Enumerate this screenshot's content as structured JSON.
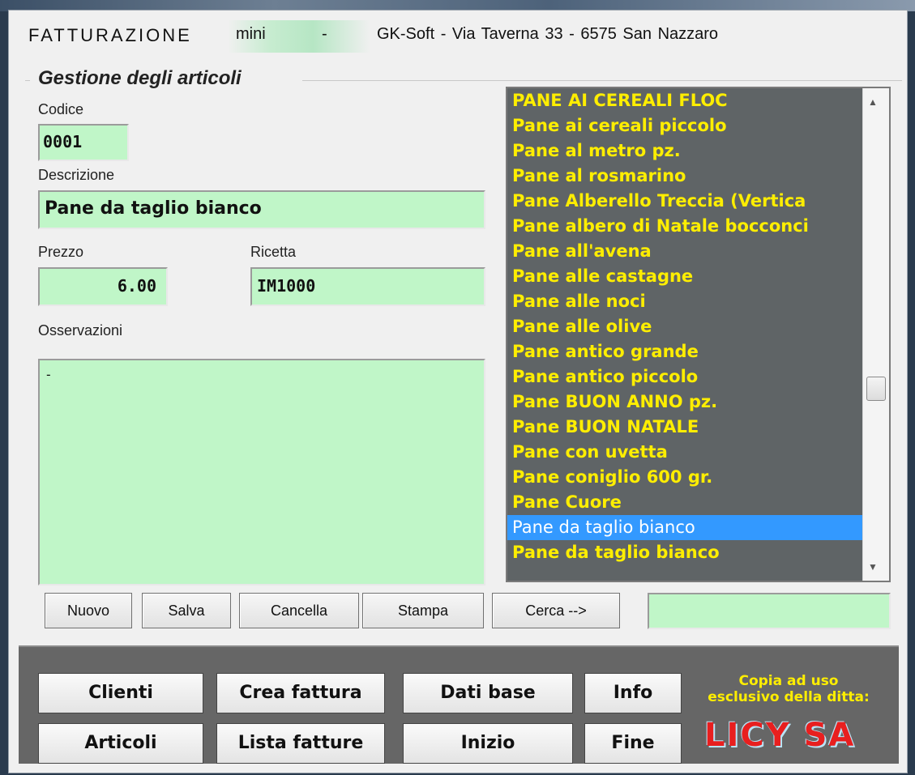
{
  "title": {
    "app_name": "FATTURAZIONE",
    "edition": "mini",
    "edition_sep": "-",
    "company": "GK-Soft  -  Via Taverna 33  -  6575 San Nazzaro"
  },
  "form": {
    "group_title": "Gestione degli articoli",
    "codice_label": "Codice",
    "codice_value": "0001",
    "descrizione_label": "Descrizione",
    "descrizione_value": "Pane da taglio bianco",
    "prezzo_label": "Prezzo",
    "prezzo_value": "6.00",
    "ricetta_label": "Ricetta",
    "ricetta_value": "IM1000",
    "osservazioni_label": "Osservazioni",
    "osservazioni_value": "-"
  },
  "articles_list": {
    "items": [
      "PANE AI CEREALI FLOC",
      "Pane ai cereali piccolo",
      "Pane al metro pz.",
      "Pane al rosmarino",
      "Pane Alberello Treccia (Vertica",
      "Pane albero di Natale bocconci",
      "Pane all'avena",
      "Pane alle castagne",
      "Pane alle noci",
      "Pane alle olive",
      "Pane antico grande",
      "Pane antico piccolo",
      "Pane BUON ANNO pz.",
      "Pane BUON NATALE",
      "Pane con uvetta",
      "Pane coniglio 600 gr.",
      "Pane Cuore",
      "Pane da taglio bianco",
      "Pane da taglio bianco"
    ],
    "selected_index": 17,
    "scroll_up_glyph": "▲",
    "scroll_down_glyph": "▼"
  },
  "actions": {
    "nuovo": "Nuovo",
    "salva": "Salva",
    "cancella": "Cancella",
    "stampa": "Stampa",
    "cerca": "Cerca -->",
    "search_value": ""
  },
  "nav": {
    "clienti": "Clienti",
    "crea_fattura": "Crea fattura",
    "dati_base": "Dati base",
    "info": "Info",
    "articoli": "Articoli",
    "lista_fatture": "Lista fatture",
    "inizio": "Inizio",
    "fine": "Fine"
  },
  "license": {
    "line1": "Copia ad uso",
    "line2": "esclusivo della ditta:",
    "company": "LICY  SA"
  },
  "colors": {
    "field_bg": "#c0f6c8",
    "list_bg": "#5f6466",
    "list_text": "#ffee00",
    "selection": "#3399ff",
    "brand_red": "#e81f1f"
  }
}
